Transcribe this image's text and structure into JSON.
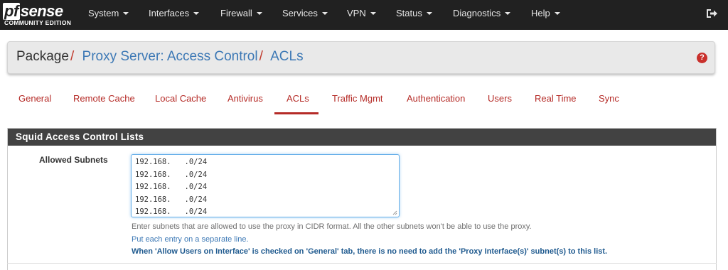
{
  "brand": {
    "name": "sense",
    "prefix": "pf",
    "edition": "COMMUNITY EDITION"
  },
  "nav": [
    {
      "label": "System"
    },
    {
      "label": "Interfaces"
    },
    {
      "label": "Firewall"
    },
    {
      "label": "Services"
    },
    {
      "label": "VPN"
    },
    {
      "label": "Status"
    },
    {
      "label": "Diagnostics"
    },
    {
      "label": "Help"
    }
  ],
  "breadcrumb": {
    "root": "Package",
    "link1": "Proxy Server: Access Control",
    "link2": "ACLs",
    "separator": "/"
  },
  "tabs": [
    {
      "label": "General"
    },
    {
      "label": "Remote Cache"
    },
    {
      "label": "Local Cache"
    },
    {
      "label": "Antivirus"
    },
    {
      "label": "ACLs",
      "active": true
    },
    {
      "label": "Traffic Mgmt"
    },
    {
      "label": "Authentication"
    },
    {
      "label": "Users"
    },
    {
      "label": "Real Time"
    },
    {
      "label": "Sync"
    }
  ],
  "panel": {
    "title": "Squid Access Control Lists",
    "allowed_subnets": {
      "label": "Allowed Subnets",
      "lines": [
        "192.168.   .0/24",
        "192.168.   .0/24",
        "192.168.   .0/24",
        "192.168.   .0/24",
        "192.168.   .0/24"
      ],
      "help1": "Enter subnets that are allowed to use the proxy in CIDR format. All the other subnets won't be able to use the proxy.",
      "help2": "Put each entry on a separate line.",
      "help3": "When 'Allow Users on Interface' is checked on 'General' tab, there is no need to add the 'Proxy Interface(s)' subnet(s) to this list."
    }
  },
  "colors": {
    "navbar": "#212121",
    "accent_red": "#b52b27",
    "link_blue": "#3c78b5",
    "panel_head": "#424242"
  }
}
